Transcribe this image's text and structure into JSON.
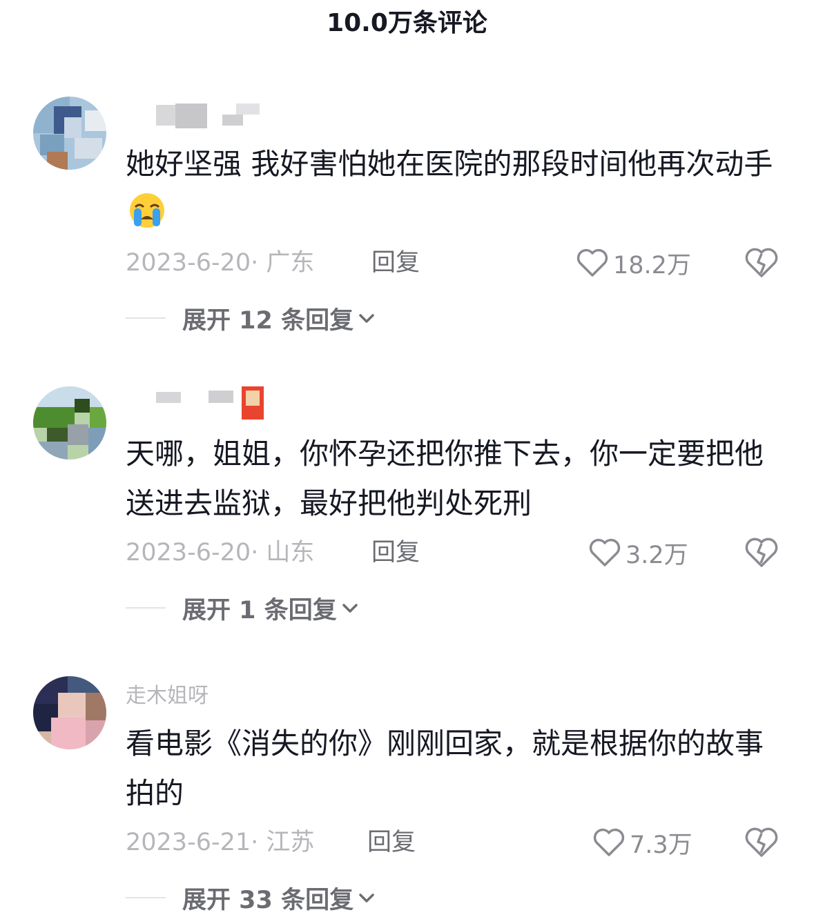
{
  "header": {
    "title": "10.0万条评论"
  },
  "comments": [
    {
      "username": "",
      "text": "她好坚强 我好害怕她在医院的那段时间他再次动手",
      "emoji": "loudly-crying-face",
      "date": "2023-6-20· 广东",
      "reply_label": "回复",
      "likes": "18.2万",
      "expand_label": "展开 12 条回复"
    },
    {
      "username": "",
      "text": "天哪，姐姐，你怀孕还把你推下去，你一定要把他送进去监狱，最好把他判处死刑",
      "date": "2023-6-20· 山东",
      "reply_label": "回复",
      "likes": "3.2万",
      "expand_label": "展开 1 条回复"
    },
    {
      "username": "走木姐呀",
      "text": "看电影《消失的你》刚刚回家，就是根据你的故事拍的",
      "date": "2023-6-21· 江苏",
      "reply_label": "回复",
      "likes": "7.3万",
      "expand_label": "展开 33 条回复"
    }
  ],
  "icons": {
    "like": "heart-outline-icon",
    "dislike": "broken-heart-icon",
    "expand": "chevron-down-icon"
  },
  "colors": {
    "primary_text": "#161823",
    "secondary_text": "#b5b6ba",
    "action_text": "#6b6c72"
  }
}
